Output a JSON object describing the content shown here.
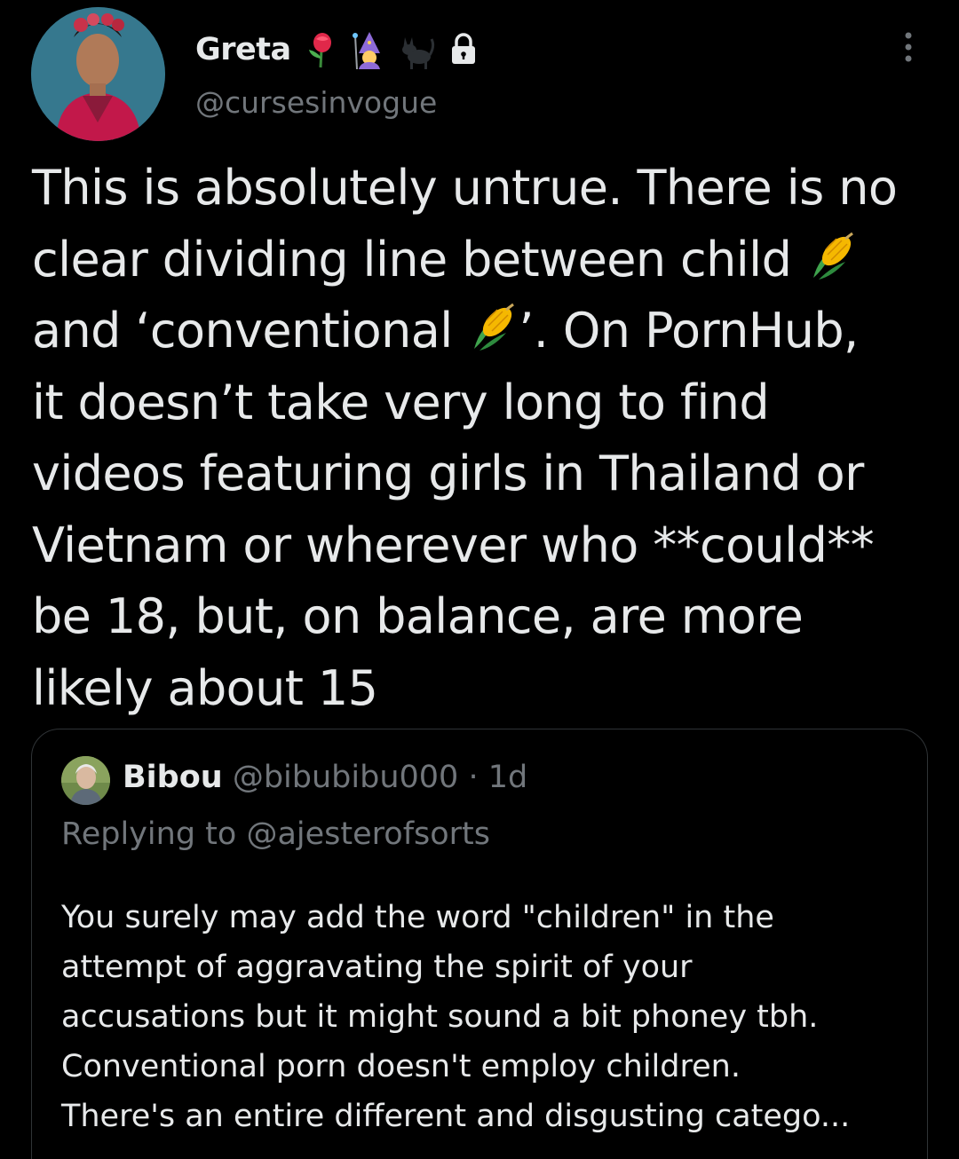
{
  "tweet": {
    "author": {
      "display_name": "Greta",
      "handle": "@cursesinvogue",
      "name_emojis": [
        "rose-icon",
        "mage-icon",
        "black-cat-icon"
      ],
      "protected_icon": "lock-icon"
    },
    "more_icon": "more-options-icon",
    "text_lines": [
      "This is absolutely untrue. There is no",
      "clear dividing line between child",
      "and ‘conventional",
      "’. On PornHub,",
      "it doesn’t take very long to find",
      "videos featuring girls in Thailand or",
      "Vietnam or wherever who **could**",
      "be 18, but, on balance, are more",
      "likely about 15"
    ],
    "inline_emoji": "corn-icon"
  },
  "quoted_tweet": {
    "display_name": "Bibou",
    "handle": "@bibubibu000",
    "separator": "·",
    "time": "1d",
    "replying_to_prefix": "Replying to",
    "replying_to_handle": "@ajesterofsorts",
    "text_lines": [
      "You surely may add the word \"children\" in the",
      "attempt of aggravating the spirit of your",
      "accusations but it might sound a bit phoney tbh.",
      "Conventional porn doesn't employ children.",
      "There's an entire different and disgusting catego..."
    ]
  },
  "colors": {
    "background": "#000000",
    "text_primary": "#e7e9ea",
    "text_secondary": "#71767b",
    "border": "#2f3336"
  }
}
